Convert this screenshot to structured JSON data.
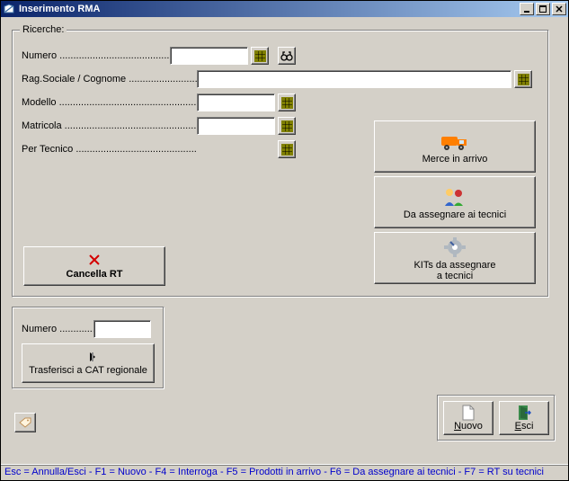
{
  "window": {
    "title": "Inserimento RMA"
  },
  "group_main": {
    "legend": "Ricerche:"
  },
  "fields": {
    "numero": {
      "label": "Numero",
      "value": ""
    },
    "ragsoc": {
      "label": "Rag.Sociale / Cognome",
      "value": ""
    },
    "modello": {
      "label": "Modello",
      "value": ""
    },
    "matricola": {
      "label": "Matricola",
      "value": ""
    },
    "tecnico": {
      "label": "Per Tecnico",
      "value": ""
    }
  },
  "buttons": {
    "cancella": "Cancella RT",
    "merce": "Merce in arrivo",
    "assegnare": "Da assegnare ai tecnici",
    "kits_line1": "KITs da assegnare",
    "kits_line2": "a tecnici",
    "nuovo": "Nuovo",
    "esci": "Esci",
    "trasferisci": "Trasferisci a CAT regionale"
  },
  "second_numero": {
    "label": "Numero",
    "value": ""
  },
  "statusbar": "Esc = Annulla/Esci - F1 = Nuovo - F4 = Interroga - F5 = Prodotti in arrivo - F6 = Da assegnare ai tecnici - F7 = RT su tecnici"
}
